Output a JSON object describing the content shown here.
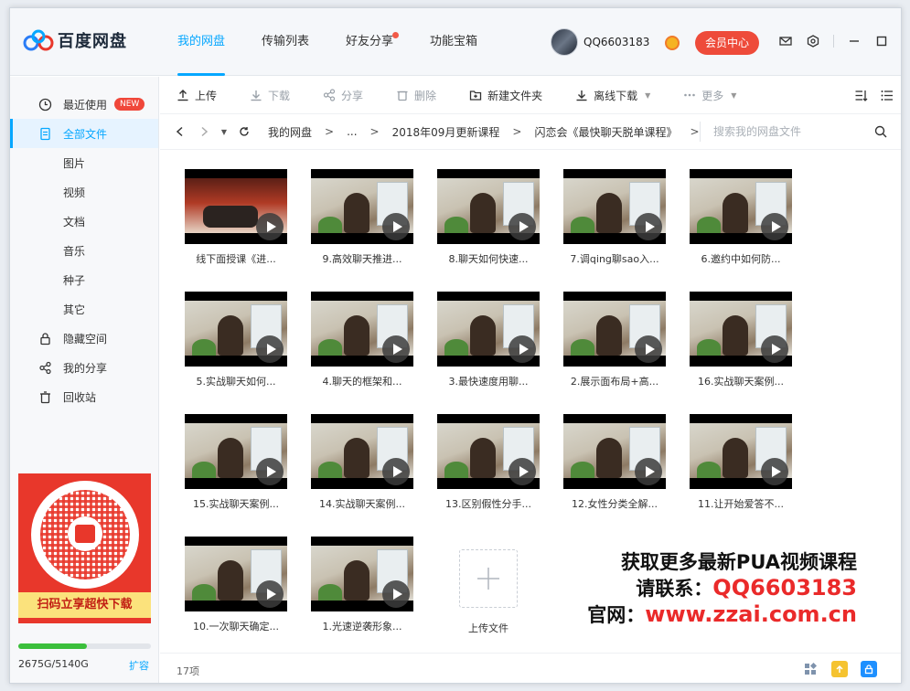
{
  "app": {
    "name": "百度网盘"
  },
  "nav": {
    "tabs": [
      {
        "label": "我的网盘"
      },
      {
        "label": "传输列表"
      },
      {
        "label": "好友分享"
      },
      {
        "label": "功能宝箱"
      }
    ]
  },
  "user": {
    "name": "QQ6603183",
    "vip_label": "会员中心"
  },
  "sidebar": {
    "items": [
      {
        "label": "最近使用",
        "badge": "NEW"
      },
      {
        "label": "全部文件"
      },
      {
        "label": "图片"
      },
      {
        "label": "视频"
      },
      {
        "label": "文档"
      },
      {
        "label": "音乐"
      },
      {
        "label": "种子"
      },
      {
        "label": "其它"
      },
      {
        "label": "隐藏空间"
      },
      {
        "label": "我的分享"
      },
      {
        "label": "回收站"
      }
    ],
    "promo_label": "扫码立享超快下载",
    "storage": {
      "used_text": "2675G/5140G",
      "fraction": 0.52,
      "expand": "扩容"
    }
  },
  "toolbar": {
    "upload": "上传",
    "download": "下载",
    "share": "分享",
    "delete": "删除",
    "new_folder": "新建文件夹",
    "offline": "离线下载",
    "more": "更多"
  },
  "breadcrumb": {
    "items": [
      "我的网盘",
      "...",
      "2018年09月更新课程",
      "闪恋会《最快聊天脱单课程》"
    ],
    "sep": ">"
  },
  "search": {
    "placeholder": "搜索我的网盘文件"
  },
  "files": [
    "线下面授课《进...",
    "9.高效聊天推进...",
    "8.聊天如何快速...",
    "7.调qing聊sao入...",
    "6.邀约中如何防...",
    "5.实战聊天如何...",
    "4.聊天的框架和...",
    "3.最快速度用聊...",
    "2.展示面布局+高...",
    "16.实战聊天案例...",
    "15.实战聊天案例...",
    "14.实战聊天案例...",
    "13.区别假性分手...",
    "12.女性分类全解...",
    "11.让开始爱答不...",
    "10.一次聊天确定...",
    "1.光速逆袭形象..."
  ],
  "upload_tile": "上传文件",
  "overlay": {
    "line1": "获取更多最新PUA视频课程",
    "line2_prefix": "请联系：",
    "line2_value": "QQ6603183",
    "line3_prefix": "官网：",
    "line3_value": "www.zzai.com.cn"
  },
  "footer": {
    "count": "17项"
  },
  "colors": {
    "accent": "#06a7ff",
    "vip": "#ee4b3a",
    "highlight": "#ea2a2a"
  }
}
